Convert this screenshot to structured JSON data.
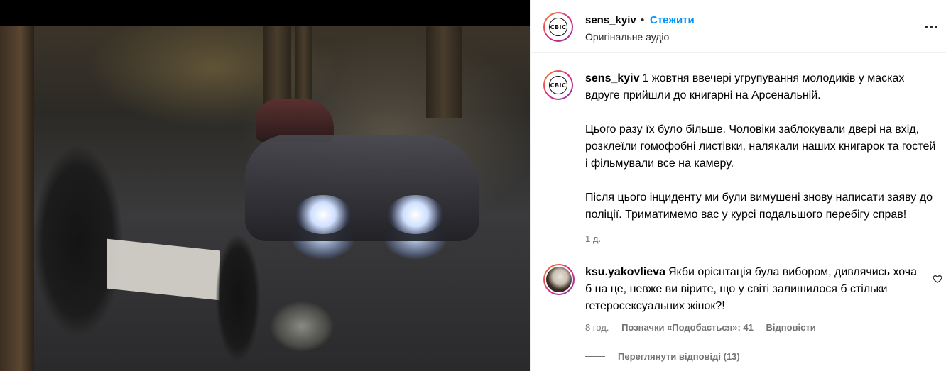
{
  "post": {
    "author": "sens_kyiv",
    "separator": "•",
    "follow_label": "Стежити",
    "audio_label": "Оригінальне аудіо",
    "avatar_text": "СВІС",
    "more_icon": "more-horizontal-icon"
  },
  "caption": {
    "author": "sens_kyiv",
    "paragraphs": [
      "1 жовтня ввечері угрупування молодиків у масках вдруге прийшли до книгарні на Арсенальній.",
      "Цього разу їх було більше. Чоловіки заблокували двері на вхід, розклеїли гомофобні листівки, налякали наших книгарок та гостей і фільмували все на камеру.",
      "Після цього інциденту ми були вимушені знову написати заяву до поліції. Триматимемо вас у курсі подальшого перебігу справ!"
    ],
    "time": "1 д."
  },
  "comment": {
    "author": "ksu.yakovlieva",
    "text": "Якби орієнтація була вибором, дивлячись хоча б на це, невже ви вірите, що у світі залишилося б стільки гетеросексуальних жінок?!",
    "time": "8 год.",
    "likes": "Позначки «Подобається»: 41",
    "reply_label": "Відповісти",
    "view_replies": "Переглянути відповіді (13)"
  },
  "colors": {
    "accent": "#0095f6",
    "muted": "#737373",
    "ring_start": "#f58529",
    "ring_mid": "#dd2a7b",
    "ring_end": "#8134af"
  }
}
